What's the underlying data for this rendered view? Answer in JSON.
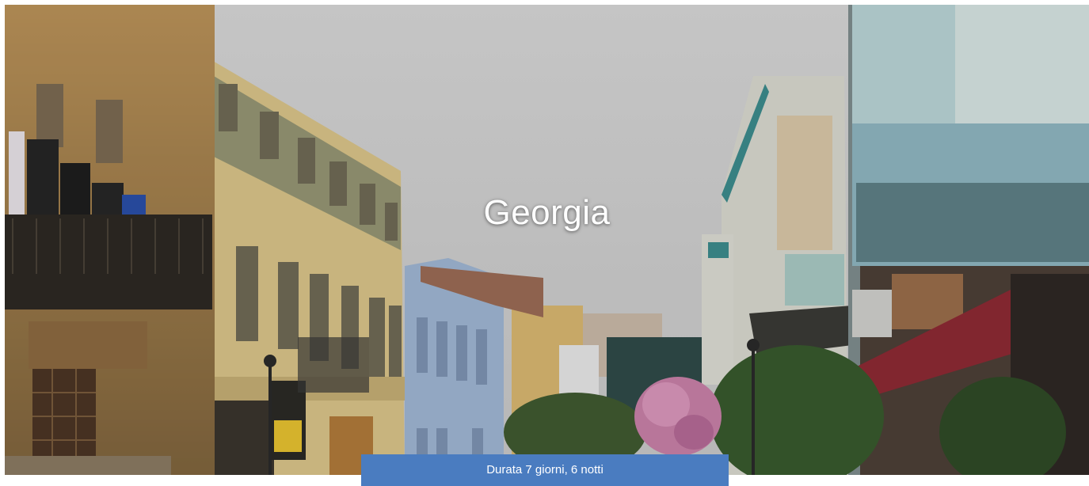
{
  "hero": {
    "title": "Georgia",
    "image": "street-photo-old-town"
  },
  "trip": {
    "duration_label": "Durata 7 giorni, 6 notti"
  },
  "colors": {
    "duration_bar": "#4a7cc0",
    "title_text": "#ffffff"
  }
}
